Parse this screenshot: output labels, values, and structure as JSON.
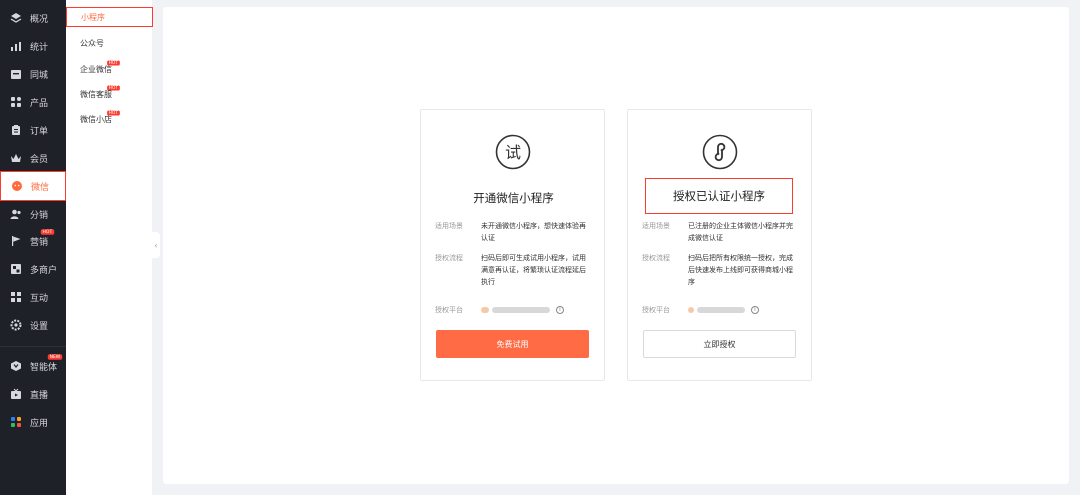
{
  "nav": {
    "items": [
      {
        "label": "概况",
        "icon": "layers-icon"
      },
      {
        "label": "统计",
        "icon": "chart-icon"
      },
      {
        "label": "同城",
        "icon": "store-icon"
      },
      {
        "label": "产品",
        "icon": "grid-icon"
      },
      {
        "label": "订单",
        "icon": "clipboard-icon"
      },
      {
        "label": "会员",
        "icon": "crown-icon"
      },
      {
        "label": "微信",
        "icon": "wechat-icon"
      },
      {
        "label": "分销",
        "icon": "users-icon"
      },
      {
        "label": "营销",
        "icon": "flag-icon",
        "badge": "HOT"
      },
      {
        "label": "多商户",
        "icon": "shop-icon"
      },
      {
        "label": "互动",
        "icon": "apps-icon"
      },
      {
        "label": "设置",
        "icon": "gear-icon"
      },
      {
        "label": "智能体",
        "icon": "robot-icon",
        "badge": "NEW"
      },
      {
        "label": "直播",
        "icon": "tv-icon"
      },
      {
        "label": "应用",
        "icon": "colorful-grid-icon"
      }
    ]
  },
  "submenu": {
    "items": [
      {
        "label": "小程序"
      },
      {
        "label": "公众号"
      },
      {
        "label": "企业微信",
        "badge": "HOT"
      },
      {
        "label": "微信客服",
        "badge": "HOT"
      },
      {
        "label": "微信小店",
        "badge": "HOT"
      }
    ]
  },
  "cards": {
    "trial": {
      "icon_text": "试",
      "title": "开通微信小程序",
      "scene_label": "适用场景",
      "scene_text": "未开通微信小程序，想快速体验再认证",
      "flow_label": "授权流程",
      "flow_text": "扫码后即可生成试用小程序，试用满意再认证，将繁琐认证流程延后执行",
      "platform_label": "授权平台",
      "button": "免费试用"
    },
    "auth": {
      "title": "授权已认证小程序",
      "scene_label": "适用场景",
      "scene_text": "已注册的企业主体微信小程序并完成微信认证",
      "flow_label": "授权流程",
      "flow_text": "扫码后把所有权限统一授权，完成后快速发布上线即可获得商城小程序",
      "platform_label": "授权平台",
      "button": "立即授权"
    }
  },
  "colors": {
    "accent": "#ff6b45",
    "highlight_border": "#ff3b30",
    "nav_bg": "#1f2128"
  }
}
